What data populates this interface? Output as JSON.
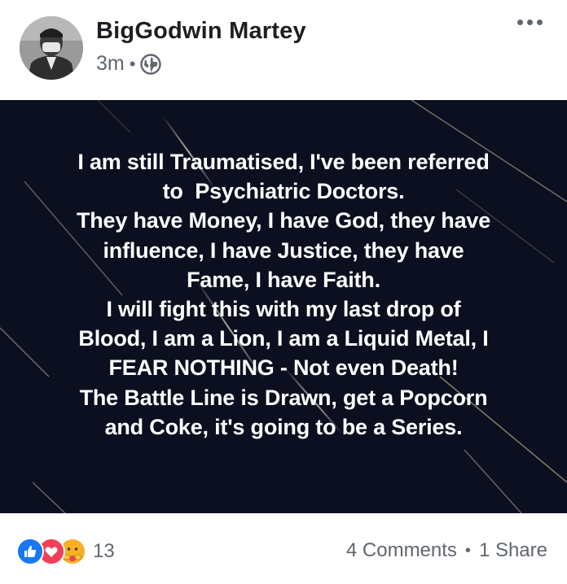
{
  "post": {
    "author": "BigGodwin Martey",
    "time": "3m",
    "separator": "•",
    "privacy_icon": "globe-icon",
    "menu_icon": "more-options-icon"
  },
  "image": {
    "background_color": "#0b0f1f",
    "text_color": "#ffffff",
    "lines": [
      "I am still Traumatised, I've been referred",
      "to  Psychiatric Doctors.",
      "They have Money, I have God, they have",
      "influence, I have Justice, they have",
      "Fame, I have Faith.",
      "I will fight this with my last drop of",
      "Blood, I am a Lion, I am a Liquid Metal, I",
      "FEAR NOTHING - Not even Death!",
      "The Battle Line is Drawn, get a Popcorn",
      "and Coke, it's going to be a Series."
    ]
  },
  "footer": {
    "reactions": [
      "like-icon",
      "love-icon",
      "care-icon"
    ],
    "reaction_count": "13",
    "comments": "4 Comments",
    "separator": "•",
    "shares": "1 Share"
  },
  "colors": {
    "like": "#1877f2",
    "love": "#f33e58",
    "care": "#f7b125",
    "secondary_text": "#606770"
  }
}
